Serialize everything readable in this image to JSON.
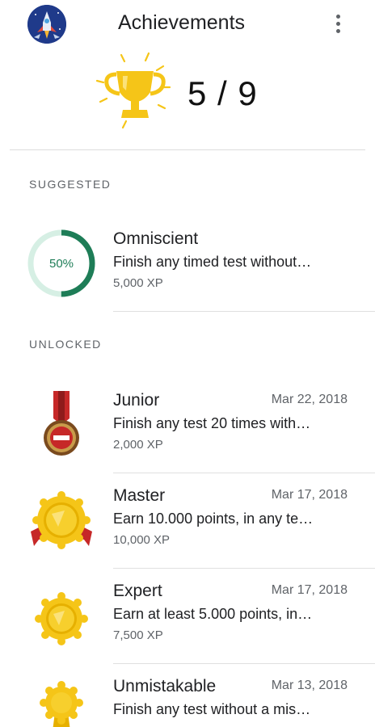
{
  "app_bar": {
    "title": "Achievements",
    "app_icon": "rocket-app-icon",
    "overflow_icon": "more-vert-icon"
  },
  "summary": {
    "score": "5 / 9",
    "icon": "trophy-icon",
    "unlocked": 5,
    "total": 9
  },
  "sections": {
    "suggested_label": "SUGGESTED",
    "unlocked_label": "UNLOCKED"
  },
  "suggested": [
    {
      "title": "Omniscient",
      "description": "Finish any timed test without…",
      "xp": "5,000 XP",
      "progress_label": "50%",
      "progress": 0.5
    }
  ],
  "unlocked": [
    {
      "title": "Junior",
      "date": "Mar 22, 2018",
      "description": "Finish any test 20 times with…",
      "xp": "2,000 XP",
      "icon": "red-medal-icon"
    },
    {
      "title": "Master",
      "date": "Mar 17, 2018",
      "description": "Earn 10.000 points, in any te…",
      "xp": "10,000 XP",
      "icon": "gold-medal-ribbon-icon"
    },
    {
      "title": "Expert",
      "date": "Mar 17, 2018",
      "description": "Earn at least 5.000 points, in…",
      "xp": "7,500 XP",
      "icon": "gold-medal-icon"
    },
    {
      "title": "Unmistakable",
      "date": "Mar 13, 2018",
      "description": "Finish any test without a mis…",
      "xp": "",
      "icon": "gold-rosette-icon"
    }
  ],
  "colors": {
    "progress_track": "#d6efe4",
    "progress_fill": "#1e7d57",
    "gold": "#f5c518",
    "red": "#c62828"
  }
}
